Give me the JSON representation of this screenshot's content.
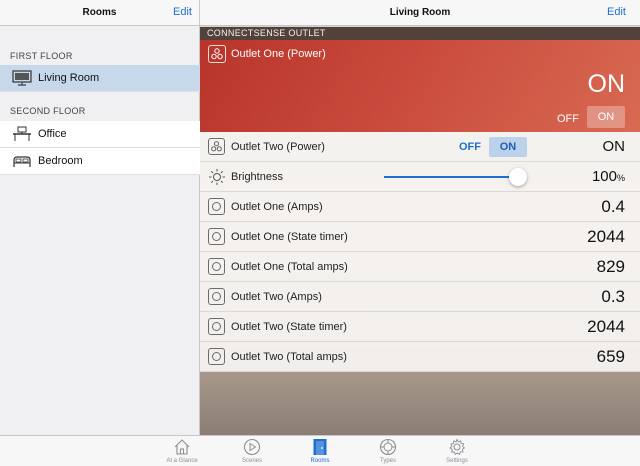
{
  "sidebar": {
    "title": "Rooms",
    "edit_label": "Edit",
    "sections": [
      {
        "header": "FIRST FLOOR",
        "rooms": [
          {
            "label": "Living Room",
            "icon": "tv-icon",
            "selected": true
          }
        ]
      },
      {
        "header": "SECOND FLOOR",
        "rooms": [
          {
            "label": "Office",
            "icon": "desk-icon"
          },
          {
            "label": "Bedroom",
            "icon": "bed-icon"
          }
        ]
      }
    ]
  },
  "main": {
    "title": "Living Room",
    "edit_label": "Edit",
    "device_header": "CONNECTSENSE OUTLET",
    "hero": {
      "label": "Outlet One (Power)",
      "state": "ON",
      "off_label": "OFF",
      "on_label": "ON"
    },
    "rows": [
      {
        "label": "Outlet Two (Power)",
        "value": "ON",
        "off_label": "OFF",
        "on_label": "ON"
      },
      {
        "label": "Brightness",
        "value": "100",
        "unit": "%",
        "level": 1.0
      },
      {
        "label": "Outlet One (Amps)",
        "value": "0.4"
      },
      {
        "label": "Outlet One (State timer)",
        "value": "2044"
      },
      {
        "label": "Outlet One (Total amps)",
        "value": "829"
      },
      {
        "label": "Outlet Two (Amps)",
        "value": "0.3"
      },
      {
        "label": "Outlet Two (State timer)",
        "value": "2044"
      },
      {
        "label": "Outlet Two (Total amps)",
        "value": "659"
      }
    ]
  },
  "tabbar": {
    "tabs": [
      {
        "label": "At a Glance",
        "icon": "house-icon"
      },
      {
        "label": "Scenes",
        "icon": "play-icon"
      },
      {
        "label": "Rooms",
        "icon": "door-icon",
        "active": true
      },
      {
        "label": "Types",
        "icon": "types-icon"
      },
      {
        "label": "Settings",
        "icon": "gear-icon"
      }
    ]
  },
  "colors": {
    "accent": "#1f6fd1",
    "hero_red": "#c94a3c",
    "selected_row": "#c6d8ea"
  }
}
